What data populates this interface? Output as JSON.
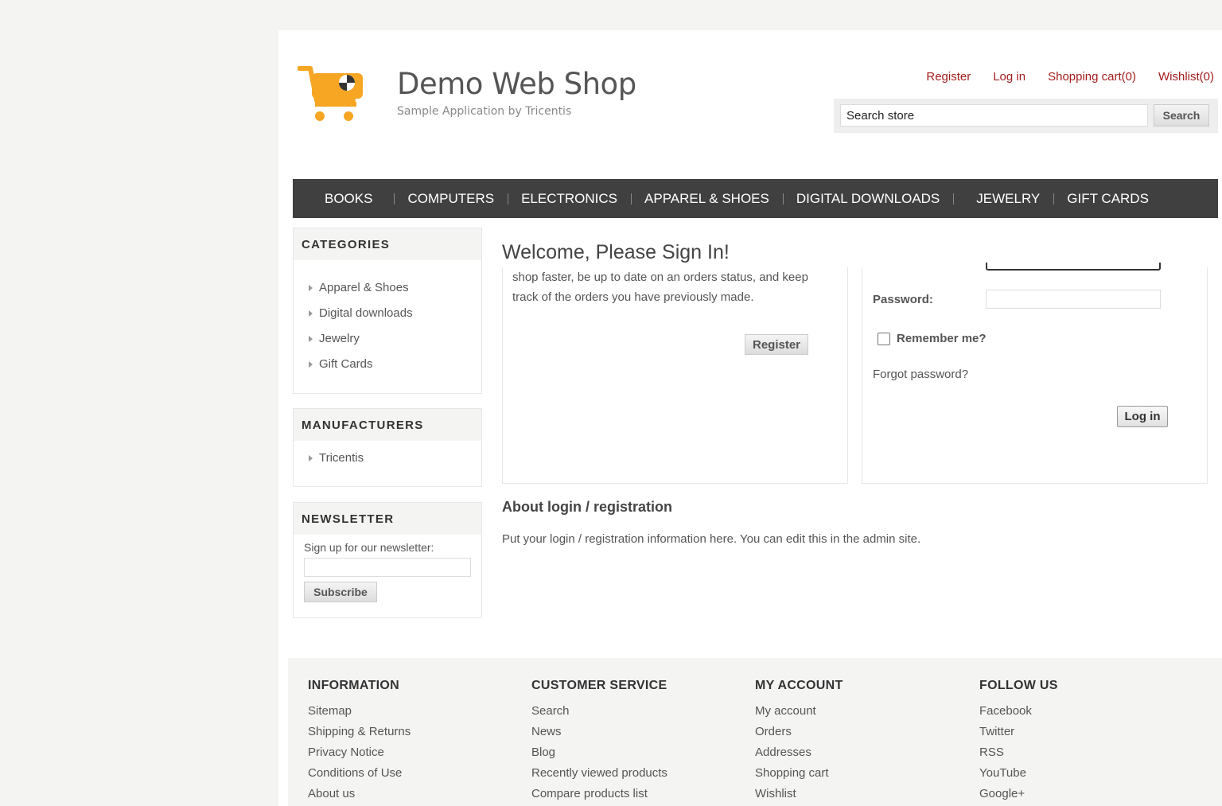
{
  "header": {
    "logo_title": "Demo Web Shop",
    "logo_subtitle": "Sample Application by Tricentis",
    "links": [
      "Register",
      "Log in",
      "Shopping cart(0)",
      "Wishlist(0)"
    ],
    "search_placeholder": "Search store",
    "search_button": "Search"
  },
  "menu": [
    "BOOKS",
    "COMPUTERS",
    "ELECTRONICS",
    "APPAREL & SHOES",
    "DIGITAL DOWNLOADS",
    "JEWELRY",
    "GIFT CARDS"
  ],
  "sidebar": {
    "categories_title": "CATEGORIES",
    "categories": [
      "Apparel & Shoes",
      "Digital downloads",
      "Jewelry",
      "Gift Cards"
    ],
    "manufacturers_title": "MANUFACTURERS",
    "manufacturers": [
      "Tricentis"
    ],
    "newsletter_title": "NEWSLETTER",
    "newsletter_label": "Sign up for our newsletter:",
    "subscribe_button": "Subscribe"
  },
  "main": {
    "page_title": "Welcome, Please Sign In!",
    "new_customer_text_line1": "shop faster, be up to date on an orders status, and keep",
    "new_customer_text_line2": "track of the orders you have previously made.",
    "register_button": "Register",
    "password_label": "Password:",
    "remember_label": "Remember me?",
    "forgot_link": "Forgot password?",
    "login_button": "Log in",
    "about_title": "About login / registration",
    "about_text": "Put your login / registration information here. You can edit this in the admin site."
  },
  "footer": {
    "columns": [
      {
        "title": "INFORMATION",
        "links": [
          "Sitemap",
          "Shipping & Returns",
          "Privacy Notice",
          "Conditions of Use",
          "About us"
        ]
      },
      {
        "title": "CUSTOMER SERVICE",
        "links": [
          "Search",
          "News",
          "Blog",
          "Recently viewed products",
          "Compare products list"
        ]
      },
      {
        "title": "MY ACCOUNT",
        "links": [
          "My account",
          "Orders",
          "Addresses",
          "Shopping cart",
          "Wishlist"
        ]
      },
      {
        "title": "FOLLOW US",
        "links": [
          "Facebook",
          "Twitter",
          "RSS",
          "YouTube",
          "Google+"
        ]
      }
    ]
  },
  "colors": {
    "link_red": "#a41d1d",
    "menu_bg": "#404040",
    "logo_orange": "#f6a623"
  }
}
